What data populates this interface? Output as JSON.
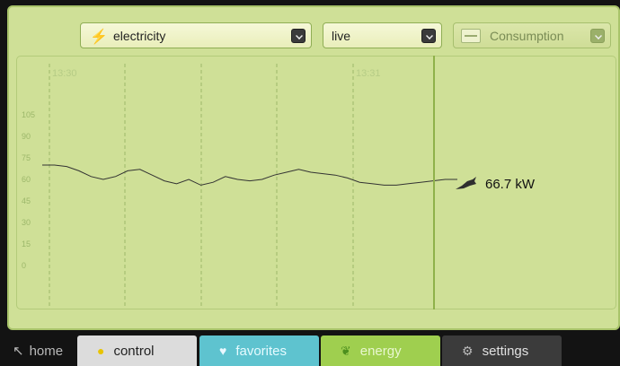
{
  "toolbar": {
    "type_select": {
      "value": "electricity",
      "icon": "lightning-bolt-icon"
    },
    "mode_select": {
      "value": "live"
    },
    "view_select": {
      "value": "Consumption",
      "disabled": true,
      "icon": "meter-panel-icon"
    }
  },
  "chart_data": {
    "type": "line",
    "x_tick_labels": [
      "13:30",
      "13:31"
    ],
    "y_ticks": [
      0,
      15,
      30,
      45,
      60,
      75,
      90,
      105
    ],
    "ylim": [
      0,
      105
    ],
    "series": [
      {
        "values": [
          70,
          70,
          69,
          66,
          62,
          60,
          62,
          66,
          67,
          63,
          59,
          57,
          60,
          56,
          58,
          62,
          60,
          59,
          60,
          63,
          65,
          67,
          65,
          64,
          63,
          61,
          58,
          57,
          56,
          56,
          57,
          58,
          59,
          60,
          60
        ]
      }
    ],
    "grid": "vertical dashed",
    "colors": {
      "line": "#333333",
      "tick": "#9cb76a"
    }
  },
  "readout": {
    "value": "66.7 kW",
    "icon": "plug-icon"
  },
  "tabs": {
    "home": {
      "label": "home",
      "icon": "back-arrow-icon"
    },
    "control": {
      "label": "control",
      "icon": "bulb-icon",
      "color": "#dcdcdc"
    },
    "favorites": {
      "label": "favorites",
      "icon": "heart-icon",
      "color": "#5ec3cf"
    },
    "energy": {
      "label": "energy",
      "icon": "leaf-icon",
      "color": "#9fcf4f",
      "active": true
    },
    "settings": {
      "label": "settings",
      "icon": "gears-icon",
      "color": "#3b3b3b"
    }
  }
}
